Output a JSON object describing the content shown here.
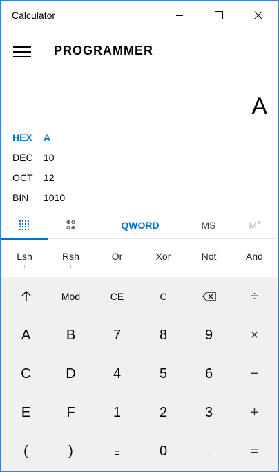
{
  "window": {
    "title": "Calculator",
    "minimize_icon": "minimize-icon",
    "maximize_icon": "maximize-icon",
    "close_icon": "close-icon"
  },
  "header": {
    "menu_icon": "hamburger-icon",
    "mode": "PROGRAMMER"
  },
  "display": {
    "value": "A"
  },
  "radix": [
    {
      "label": "HEX",
      "value": "A",
      "active": true
    },
    {
      "label": "DEC",
      "value": "10",
      "active": false
    },
    {
      "label": "OCT",
      "value": "12",
      "active": false
    },
    {
      "label": "BIN",
      "value": "1010",
      "active": false
    }
  ],
  "tabs": {
    "keypad_icon": "keypad-icon",
    "bit_toggle_icon": "bit-toggle-icon",
    "word_size": "QWORD",
    "memory_store": "MS",
    "memory_view": "M"
  },
  "bitwise_ops": [
    {
      "label": "Lsh",
      "sub": "↑"
    },
    {
      "label": "Rsh",
      "sub": "↑"
    },
    {
      "label": "Or"
    },
    {
      "label": "Xor"
    },
    {
      "label": "Not"
    },
    {
      "label": "And"
    }
  ],
  "keys": {
    "row1": [
      "↑",
      "Mod",
      "CE",
      "C",
      "backspace",
      "÷"
    ],
    "row2": [
      "A",
      "B",
      "7",
      "8",
      "9",
      "×"
    ],
    "row3": [
      "C",
      "D",
      "4",
      "5",
      "6",
      "−"
    ],
    "row4": [
      "E",
      "F",
      "1",
      "2",
      "3",
      "+"
    ],
    "row5": [
      "(",
      ")",
      "±",
      "0",
      ".",
      "="
    ]
  }
}
